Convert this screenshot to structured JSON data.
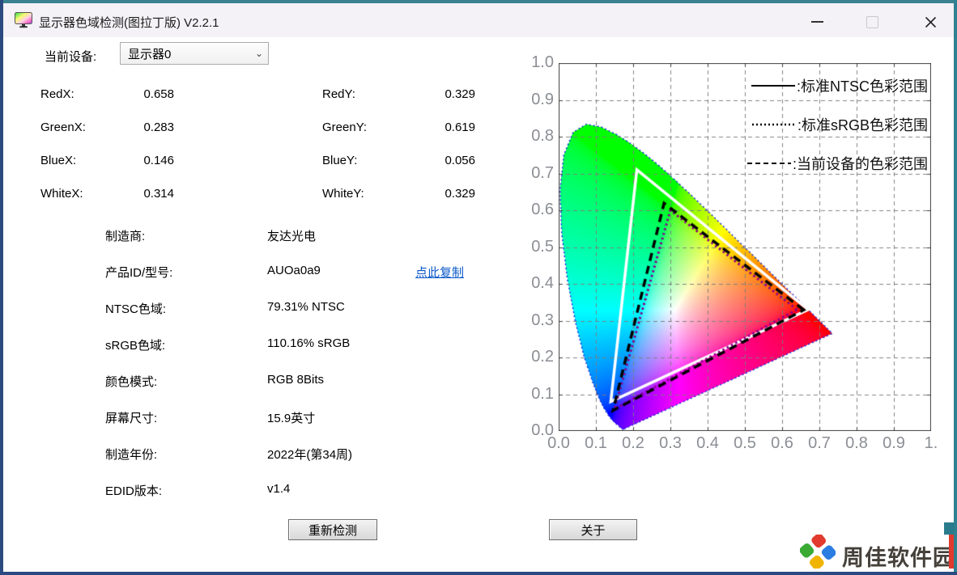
{
  "window": {
    "title": "显示器色域检测(图拉丁版) V2.2.1"
  },
  "icons": {
    "app": "color-monitor-icon",
    "minimize": "minimize-icon",
    "maximize": "maximize-icon",
    "close": "close-icon",
    "dropdown": "chevron-down-icon",
    "watermark": "pinwheel-logo-icon"
  },
  "device_selector": {
    "label": "当前设备:",
    "value": "显示器0",
    "chevron": "⌄"
  },
  "coordinates": [
    {
      "l1": "RedX:",
      "v1": "0.658",
      "l2": "RedY:",
      "v2": "0.329"
    },
    {
      "l1": "GreenX:",
      "v1": "0.283",
      "l2": "GreenY:",
      "v2": "0.619"
    },
    {
      "l1": "BlueX:",
      "v1": "0.146",
      "l2": "BlueY:",
      "v2": "0.056"
    },
    {
      "l1": "WhiteX:",
      "v1": "0.314",
      "l2": "WhiteY:",
      "v2": "0.329"
    }
  ],
  "info": [
    {
      "label": "制造商:",
      "value": "友达光电"
    },
    {
      "label": "产品ID/型号:",
      "value": "AUOa0a9",
      "link": "点此复制"
    },
    {
      "label": "NTSC色域:",
      "value": "79.31% NTSC"
    },
    {
      "label": "sRGB色域:",
      "value": "110.16% sRGB"
    },
    {
      "label": "颜色模式:",
      "value": "RGB 8Bits"
    },
    {
      "label": "屏幕尺寸:",
      "value": "15.9英寸"
    },
    {
      "label": "制造年份:",
      "value": "2022年(第34周)"
    },
    {
      "label": "EDID版本:",
      "value": "v1.4"
    }
  ],
  "buttons": {
    "redetect": "重新检测",
    "about": "关于"
  },
  "watermark": {
    "text": "周佳软件园"
  },
  "colors": {
    "border_top_teal": "#3a8191",
    "border_bottom_blue": "#2b4a7f",
    "titlebar_bg": "#f4f2f6",
    "link_blue": "#0a58ca",
    "tick_label_gray": "#8b8e94",
    "ntsc_triangle": "#ffffff",
    "srgb_triangle": "#8b008b",
    "device_triangle": "#000000",
    "locus_outline": "#2233dd"
  },
  "chart_data": {
    "type": "area",
    "subtype": "cie-1931-chromaticity-diagram",
    "title": "",
    "xlabel": "",
    "ylabel": "",
    "xlim": [
      0,
      1
    ],
    "ylim": [
      0,
      1
    ],
    "grid": "dashed",
    "legend_position": "top-right-inside",
    "x_ticks": [
      "0.0",
      "0.1",
      "0.2",
      "0.3",
      "0.4",
      "0.5",
      "0.6",
      "0.7",
      "0.8",
      "0.9",
      "1."
    ],
    "y_ticks": [
      "0.0",
      "0.1",
      "0.2",
      "0.3",
      "0.4",
      "0.5",
      "0.6",
      "0.7",
      "0.8",
      "0.9",
      "1.0"
    ],
    "legend": [
      {
        "style": "solid",
        "label": ":标准NTSC色彩范围"
      },
      {
        "style": "dotted",
        "label": ":标准sRGB色彩范围"
      },
      {
        "style": "dashed",
        "label": ":当前设备的色彩范围"
      }
    ],
    "series": [
      {
        "name": "标准NTSC色彩范围",
        "style": "solid",
        "color": "#ffffff",
        "vertices": [
          [
            0.67,
            0.33
          ],
          [
            0.21,
            0.71
          ],
          [
            0.14,
            0.08
          ]
        ]
      },
      {
        "name": "标准sRGB色彩范围",
        "style": "dotted",
        "color": "#8b008b",
        "vertices": [
          [
            0.64,
            0.33
          ],
          [
            0.3,
            0.6
          ],
          [
            0.15,
            0.06
          ]
        ]
      },
      {
        "name": "当前设备的色彩范围",
        "style": "dashed",
        "color": "#000000",
        "vertices": [
          [
            0.658,
            0.329
          ],
          [
            0.283,
            0.619
          ],
          [
            0.146,
            0.056
          ]
        ]
      }
    ],
    "spectral_locus": [
      [
        0.1741,
        0.005
      ],
      [
        0.174,
        0.005
      ],
      [
        0.1738,
        0.0049
      ],
      [
        0.1736,
        0.0049
      ],
      [
        0.1733,
        0.0048
      ],
      [
        0.173,
        0.0048
      ],
      [
        0.1726,
        0.0048
      ],
      [
        0.1721,
        0.0048
      ],
      [
        0.1714,
        0.0051
      ],
      [
        0.1703,
        0.0058
      ],
      [
        0.1689,
        0.0069
      ],
      [
        0.1669,
        0.0086
      ],
      [
        0.1644,
        0.0109
      ],
      [
        0.1611,
        0.0138
      ],
      [
        0.1566,
        0.0177
      ],
      [
        0.151,
        0.0227
      ],
      [
        0.144,
        0.0297
      ],
      [
        0.1355,
        0.0399
      ],
      [
        0.1241,
        0.0578
      ],
      [
        0.1096,
        0.0868
      ],
      [
        0.0913,
        0.1327
      ],
      [
        0.0687,
        0.2007
      ],
      [
        0.0454,
        0.295
      ],
      [
        0.0235,
        0.4127
      ],
      [
        0.0082,
        0.5384
      ],
      [
        0.0039,
        0.6548
      ],
      [
        0.0139,
        0.7502
      ],
      [
        0.0389,
        0.812
      ],
      [
        0.0743,
        0.8338
      ],
      [
        0.1142,
        0.8262
      ],
      [
        0.1547,
        0.8059
      ],
      [
        0.1929,
        0.7816
      ],
      [
        0.2296,
        0.7543
      ],
      [
        0.2658,
        0.7243
      ],
      [
        0.3016,
        0.6923
      ],
      [
        0.3373,
        0.6588
      ],
      [
        0.3731,
        0.6245
      ],
      [
        0.4087,
        0.5896
      ],
      [
        0.4441,
        0.5547
      ],
      [
        0.4784,
        0.5202
      ],
      [
        0.5125,
        0.4866
      ],
      [
        0.5448,
        0.4544
      ],
      [
        0.5752,
        0.4242
      ],
      [
        0.6029,
        0.3965
      ],
      [
        0.627,
        0.3725
      ],
      [
        0.6482,
        0.3514
      ],
      [
        0.6658,
        0.334
      ],
      [
        0.6801,
        0.3197
      ],
      [
        0.6915,
        0.3083
      ],
      [
        0.7006,
        0.2993
      ],
      [
        0.7079,
        0.292
      ],
      [
        0.714,
        0.2859
      ],
      [
        0.719,
        0.2809
      ],
      [
        0.723,
        0.277
      ],
      [
        0.726,
        0.274
      ],
      [
        0.7283,
        0.2717
      ],
      [
        0.73,
        0.27
      ],
      [
        0.732,
        0.268
      ],
      [
        0.7334,
        0.2666
      ],
      [
        0.7344,
        0.2656
      ],
      [
        0.7347,
        0.2653
      ]
    ]
  }
}
